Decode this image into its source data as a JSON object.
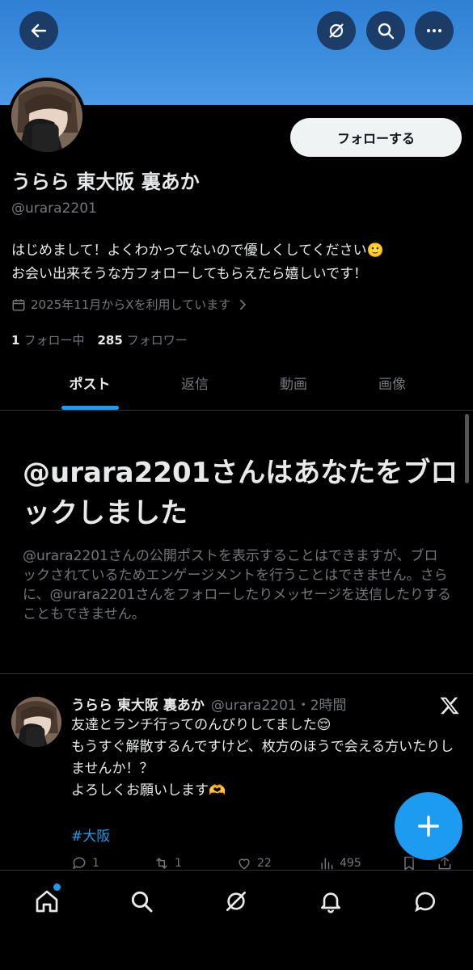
{
  "header": {
    "back_icon": "back-arrow-icon",
    "grok_icon": "grok-icon",
    "search_icon": "search-icon",
    "more_icon": "more-icon"
  },
  "profile": {
    "follow_label": "フォローする",
    "display_name": "うらら 東大阪 裏あか",
    "handle": "@urara2201",
    "bio_line1": "はじめまして！よくわかってないので優しくしてください🙂",
    "bio_line2": "お会い出来そうな方フォローしてもらえたら嬉しいです！",
    "joined": "2025年11月からXを利用しています",
    "following_count": "1",
    "following_label": "フォロー中",
    "followers_count": "285",
    "followers_label": "フォロワー"
  },
  "tabs": [
    {
      "label": "ポスト",
      "active": true
    },
    {
      "label": "返信",
      "active": false
    },
    {
      "label": "動画",
      "active": false
    },
    {
      "label": "画像",
      "active": false
    }
  ],
  "blocked": {
    "title": "@urara2201さんはあなたをブロックしました",
    "description": "@urara2201さんの公開ポストを表示することはできますが、ブロックされているためエンゲージメントを行うことはできません。さらに、@urara2201さんをフォローしたりメッセージを送信したりすることもできません。"
  },
  "tweet": {
    "name": "うらら 東大阪 裏あか",
    "meta": "@urara2201・2時間",
    "line1": "友達とランチ行ってのんびりしてました😌",
    "line2": "もうすぐ解散するんですけど、枚方のほうで会える方いたりしませんか！？",
    "line3": "よろしくお願いします🫶",
    "hashtag": "#大阪",
    "replies": "1",
    "reposts": "1",
    "likes": "22",
    "views": "495"
  },
  "colors": {
    "accent": "#1d9bf0",
    "banner": "#4a9ae8",
    "background": "#000000",
    "muted": "#71767b"
  },
  "bottom_nav": [
    "home-icon",
    "search-icon",
    "grok-icon",
    "notifications-icon",
    "messages-icon"
  ]
}
